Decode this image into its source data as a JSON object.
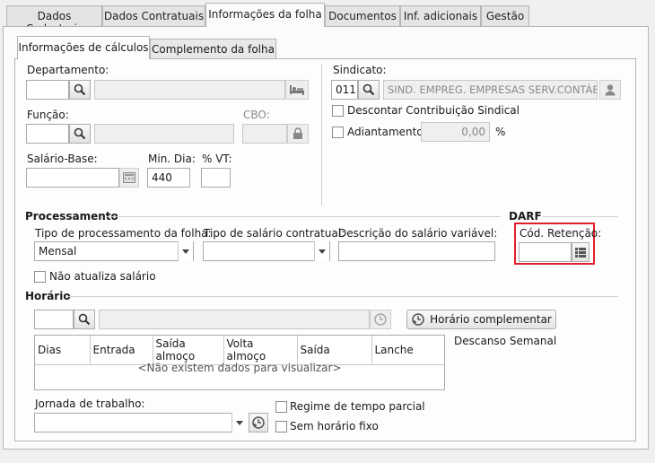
{
  "tabs": [
    "Dados Cadastrais",
    "Dados Contratuais",
    "Informações da folha",
    "Documentos",
    "Inf. adicionais",
    "Gestão"
  ],
  "subtabs": [
    "Informações de cálculos",
    "Complemento da folha"
  ],
  "departamento": {
    "label": "Departamento:",
    "code": "",
    "name": ""
  },
  "funcao": {
    "label": "Função:",
    "code": "",
    "name": ""
  },
  "cbo": {
    "label": "CBO:",
    "value": ""
  },
  "salario_base": {
    "label": "Salário-Base:",
    "value": ""
  },
  "min_dia": {
    "label": "Min. Dia:",
    "value": "440"
  },
  "pct_vt": {
    "label": "% VT:",
    "value": ""
  },
  "sindicato": {
    "label": "Sindicato:",
    "code": "011",
    "name": "SIND. EMPREG. EMPRESAS SERV.CONTÁBEIS"
  },
  "descontar_contribuicao": {
    "label": "Descontar Contribuição Sindical",
    "checked": false
  },
  "adiantamento": {
    "label": "Adiantamento",
    "value": "0,00",
    "unit": "%",
    "checked": false
  },
  "processamento": {
    "title": "Processamento",
    "tipo_proc_label": "Tipo de processamento da folha:",
    "tipo_proc_value": "Mensal",
    "tipo_salario_label": "Tipo de salário contratual:",
    "tipo_salario_value": "",
    "descricao_label": "Descrição do salário variável:",
    "descricao_value": "",
    "nao_atualiza_label": "Não atualiza salário"
  },
  "darf": {
    "title": "DARF",
    "cod_retencao_label": "Cód. Retenção:",
    "cod_retencao_value": ""
  },
  "horario": {
    "title": "Horário",
    "code": "",
    "name": "",
    "complementar_label": "Horário complementar",
    "columns": [
      "Dias",
      "Entrada",
      "Saída almoço",
      "Volta almoço",
      "Saída",
      "Lanche"
    ],
    "empty_message": "<Não existem dados para visualizar>",
    "descanso_label": "Descanso Semanal"
  },
  "jornada": {
    "label": "Jornada de trabalho:",
    "value": "",
    "regime_label": "Regime de tempo parcial",
    "sem_horario_label": "Sem horário fixo"
  },
  "colors": {
    "highlight": "#e0202a",
    "border": "#a9a9a9"
  },
  "icons": [
    "search-icon",
    "bed-icon",
    "lock-icon",
    "calculator-icon",
    "user-icon",
    "list-icon",
    "clock-add-icon",
    "chevron-down-icon"
  ]
}
